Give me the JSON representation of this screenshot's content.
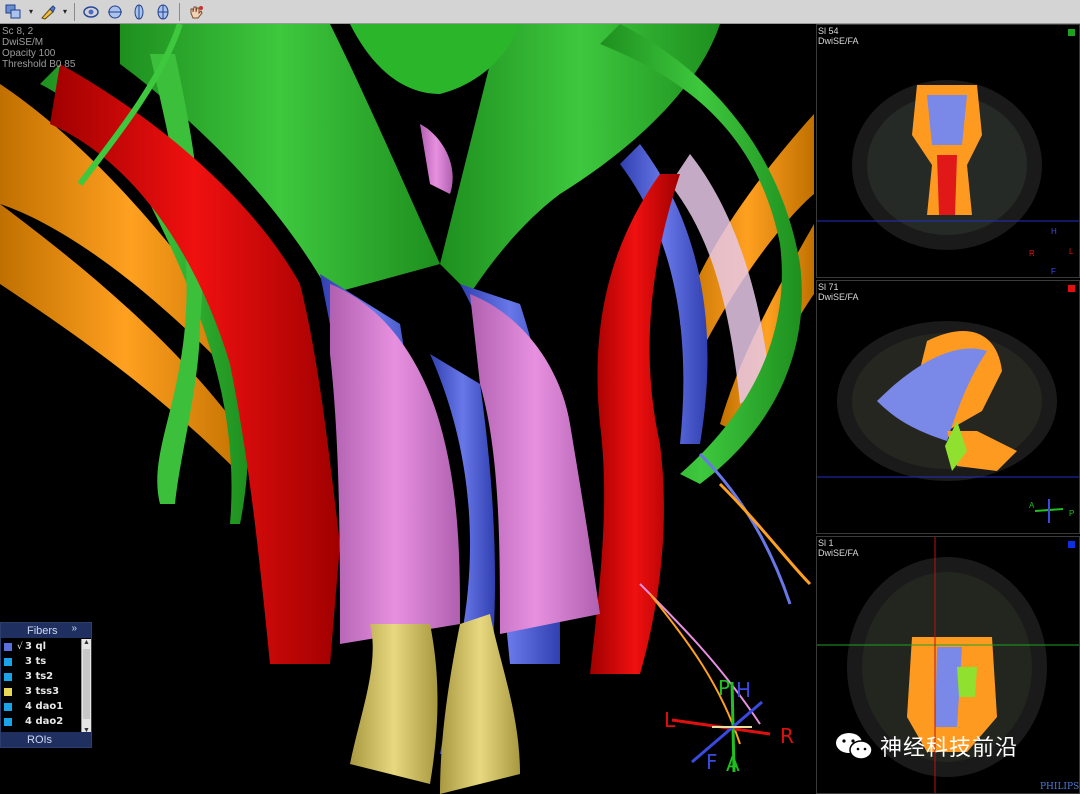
{
  "toolbar": {
    "buttons": [
      {
        "name": "window-level-tool",
        "icon": "overlapping-squares-icon"
      },
      {
        "name": "paint-tool",
        "icon": "brush-icon"
      },
      {
        "name": "view-rotate-tool",
        "icon": "eye-rotate-icon"
      },
      {
        "name": "view-axial-tool",
        "icon": "axial-view-icon"
      },
      {
        "name": "view-sagittal-tool",
        "icon": "sagittal-view-icon"
      },
      {
        "name": "view-coronal-tool",
        "icon": "coronal-view-icon"
      },
      {
        "name": "hand-tool",
        "icon": "hand-icon"
      }
    ]
  },
  "main_view": {
    "info_lines": [
      "Sc 8, 2",
      "DwiSE/M",
      "Opacity 100",
      "Threshold B0 85"
    ]
  },
  "fibers_panel": {
    "title": "Fibers",
    "expand": "»",
    "items": [
      {
        "checked": "√",
        "label": "3 ql",
        "color": "#5a6fe0"
      },
      {
        "checked": "",
        "label": "3 ts",
        "color": "#1aa3e6"
      },
      {
        "checked": "",
        "label": "3 ts2",
        "color": "#1aa3e6"
      },
      {
        "checked": "",
        "label": "3 tss3",
        "color": "#e8d85a"
      },
      {
        "checked": "",
        "label": "4 dao1",
        "color": "#1aa3e6"
      },
      {
        "checked": "",
        "label": "4 dao2",
        "color": "#1aa3e6"
      }
    ],
    "footer": "ROIs"
  },
  "orientation": {
    "labels": {
      "top1": "P",
      "top2": "H",
      "left": "L",
      "right": "R",
      "bottom1": "F",
      "bottom2": "A"
    }
  },
  "slices": [
    {
      "title": "Sl 54",
      "sub": "DwiSE/FA",
      "marker_color": "#1fa01f",
      "axes": {
        "top": "H",
        "left": "R",
        "right": "L",
        "bottom": "F"
      }
    },
    {
      "title": "Sl 71",
      "sub": "DwiSE/FA",
      "marker_color": "#e01010",
      "axes": {
        "top": "",
        "left": "A",
        "right": "P",
        "bottom": ""
      }
    },
    {
      "title": "Sl 1",
      "sub": "DwiSE/FA",
      "marker_color": "#1030e0",
      "axes": {
        "top": "",
        "left": "",
        "right": "",
        "bottom": ""
      }
    }
  ],
  "watermark": {
    "text": "神经科技前沿",
    "brand": "PHILIPS"
  }
}
